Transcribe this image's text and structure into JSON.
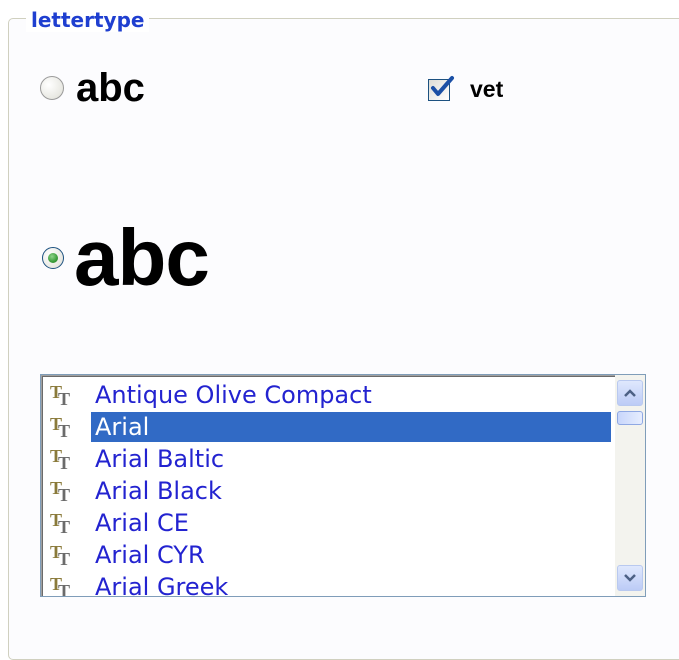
{
  "group": {
    "legend": "lettertype"
  },
  "size_options": [
    {
      "sample": "abc",
      "selected": false
    },
    {
      "sample": "abc",
      "selected": true
    }
  ],
  "bold": {
    "label": "vet",
    "checked": true
  },
  "fontlist": {
    "items": [
      "Antique Olive Compact",
      "Arial",
      "Arial Baltic",
      "Arial Black",
      "Arial CE",
      "Arial CYR",
      "Arial Greek"
    ],
    "selected_index": 1,
    "item_icon": "truetype-font-icon"
  },
  "colors": {
    "legend": "#1f3fd0",
    "list_text": "#2323d0",
    "selection": "#316ac5"
  }
}
